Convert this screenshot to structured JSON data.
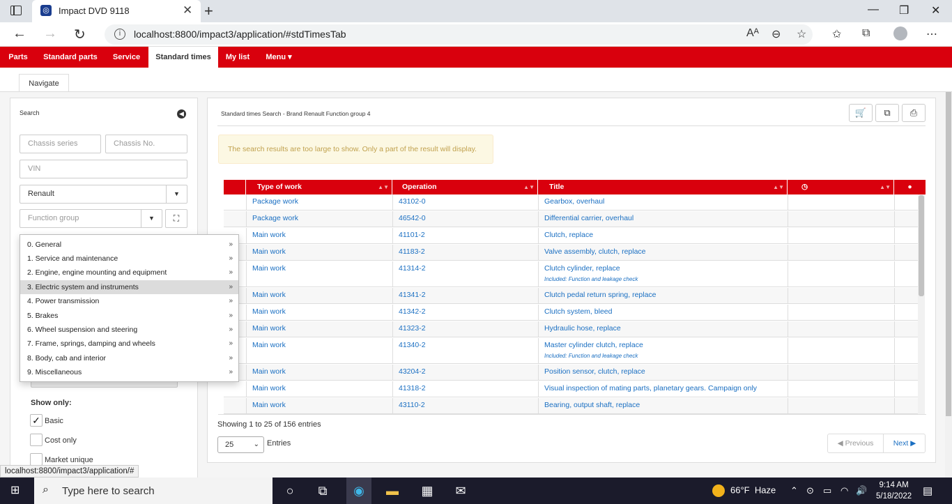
{
  "browser": {
    "tab_title": "Impact DVD 9118",
    "url": "localhost:8800/impact3/application/#stdTimesTab",
    "status_url": "localhost:8800/impact3/application/#"
  },
  "nav": {
    "items": [
      "Parts",
      "Standard parts",
      "Service",
      "Standard times",
      "My list",
      "Menu"
    ],
    "active": "Standard times"
  },
  "subtab": "Navigate",
  "search": {
    "label": "Search",
    "chassis_series": "Chassis series",
    "chassis_no": "Chassis No.",
    "vin": "VIN",
    "brand": "Renault",
    "function_group": "Function group",
    "groups": [
      "0. General",
      "1. Service and maintenance",
      "2. Engine, engine mounting and equipment",
      "3. Electric system and instruments",
      "4. Power transmission",
      "5. Brakes",
      "6. Wheel suspension and steering",
      "7. Frame, springs, damping and wheels",
      "8. Body, cab and interior",
      "9. Miscellaneous"
    ],
    "highlighted_group": 3,
    "show_only": "Show only:",
    "checkboxes": [
      {
        "label": "Basic",
        "checked": true
      },
      {
        "label": "Cost only",
        "checked": false
      },
      {
        "label": "Market unique",
        "checked": false
      }
    ]
  },
  "results": {
    "title": "Standard times Search - Brand Renault Function group 4",
    "alert": "The search results are too large to show. Only a part of the result will display.",
    "columns": [
      "Type of work",
      "Operation",
      "Title"
    ],
    "rows": [
      {
        "type": "Package work",
        "op": "43102-0",
        "title": "Gearbox, overhaul",
        "note": ""
      },
      {
        "type": "Package work",
        "op": "46542-0",
        "title": "Differential carrier, overhaul",
        "note": ""
      },
      {
        "type": "Main work",
        "op": "41101-2",
        "title": "Clutch, replace",
        "note": ""
      },
      {
        "type": "Main work",
        "op": "41183-2",
        "title": "Valve assembly, clutch, replace",
        "note": ""
      },
      {
        "type": "Main work",
        "op": "41314-2",
        "title": "Clutch cylinder, replace",
        "note": "Included: Function and leakage check"
      },
      {
        "type": "Main work",
        "op": "41341-2",
        "title": "Clutch pedal return spring, replace",
        "note": ""
      },
      {
        "type": "Main work",
        "op": "41342-2",
        "title": "Clutch system, bleed",
        "note": ""
      },
      {
        "type": "Main work",
        "op": "41323-2",
        "title": "Hydraulic hose, replace",
        "note": ""
      },
      {
        "type": "Main work",
        "op": "41340-2",
        "title": "Master cylinder clutch, replace",
        "note": "Included: Function and leakage check"
      },
      {
        "type": "Main work",
        "op": "43204-2",
        "title": "Position sensor, clutch, replace",
        "note": ""
      },
      {
        "type": "Main work",
        "op": "41318-2",
        "title": "Visual inspection of mating parts, planetary gears. Campaign only",
        "note": ""
      },
      {
        "type": "Main work",
        "op": "43110-2",
        "title": "Bearing, output shaft, replace",
        "note": ""
      }
    ],
    "showing": "Showing 1 to 25 of 156 entries",
    "page_length": "25",
    "entries_label": "Entries",
    "previous": "Previous",
    "next": "Next"
  },
  "taskbar": {
    "search_placeholder": "Type here to search",
    "weather_temp": "66°F",
    "weather_desc": "Haze",
    "time": "9:14 AM",
    "date": "5/18/2022"
  }
}
